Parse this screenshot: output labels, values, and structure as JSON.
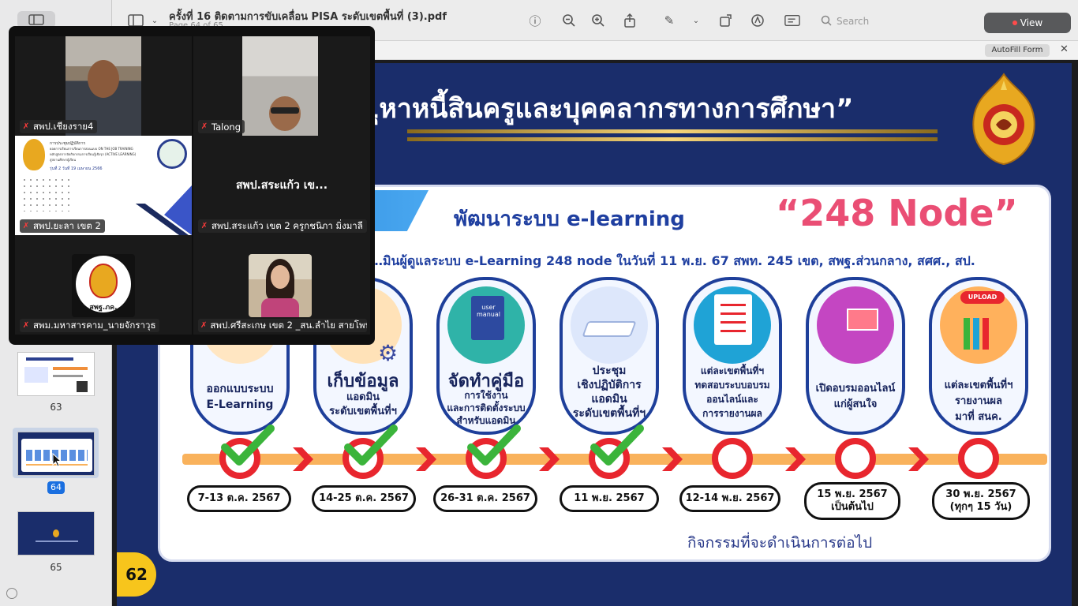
{
  "document": {
    "title": "ครั้งที่ 16 ติดตามการขับเคลื่อน PISA ระดับเขตพื้นที่ (3).pdf",
    "page_info": "Page 64 of 65"
  },
  "toolbar": {
    "search_placeholder": "Search",
    "view_label": "View",
    "autofill_label": "AutoFill Form",
    "close_label": "✕"
  },
  "sidebar": {
    "thumbnails": [
      {
        "label": "63",
        "selected": false
      },
      {
        "label": "64",
        "selected": true
      },
      {
        "label": "65",
        "selected": false
      }
    ]
  },
  "call": {
    "participants": [
      {
        "name": "สพป.เชียงราย4",
        "muted": true
      },
      {
        "name": "Talong",
        "muted": true
      },
      {
        "name": "สพป.ยะลา เขต 2",
        "muted": true
      },
      {
        "name": "สพป.สระแก้ว  เขต 2 ครูกชนิภา มิ่งมาลี",
        "muted": true,
        "display_name": "สพป.สระแก้ว  เข..."
      },
      {
        "name": "สพม.มหาสารคาม_นายจักราวุธ",
        "muted": true
      },
      {
        "name": "สพป.ศรีสะเกษ เขต 2 _สน.ลำไย สายโพน",
        "muted": true
      }
    ],
    "screen_share": {
      "line1": "การประชุมปฏิบัติการ",
      "line2": "ยอดการเรียนการเรียนการสอนแบบ ON THE JOB TRAINING",
      "line3": "หลักสูตรการจัดกิจกรรมการเรียนรู้เชิงรุก (ACTIVE LEARNING)",
      "line4": "สู่สถานศึกษาผู้เรียน",
      "date": "รุ่นที่ 2 วันที่ 19 เมษายน 2566"
    },
    "logo_caption": "สพฐ.ภค."
  },
  "slide": {
    "header": "…ุหาหนี้สินครูและบุคคลากรทางการศึกษา”",
    "panel_title": "พัฒนาระบบ e-learning",
    "panel_node": "“248 Node”",
    "panel_subtitle": "…มินผู้ดูแลระบบ e-Learning 248 node ในวันที่ 11 พ.ย. 67 สพท. 245 เขต, สพฐ.ส่วนกลาง, สศศ., สป.",
    "steps": [
      {
        "big": "",
        "text": "ออกแบบระบบ\nE-Learning",
        "status": "done",
        "date": "7-13 ต.ค. 2567"
      },
      {
        "big": "เก็บข้อมูล",
        "text": "แอดมิน\nระดับเขตพื้นที่ฯ",
        "status": "done",
        "date": "14-25 ต.ค. 2567"
      },
      {
        "big": "จัดทำคู่มือ",
        "text": "การใช้งาน\nและการติดตั้งระบบ\nสำหรับแอดมิน",
        "status": "done",
        "date": "26-31 ต.ค. 2567"
      },
      {
        "big": "",
        "text": "ประชุม\nเชิงปฏิบัติการ\nแอดมิน\nระดับเขตพื้นที่ฯ",
        "status": "done",
        "date": "11 พ.ย. 2567"
      },
      {
        "big": "",
        "text": "แต่ละเขตพื้นที่ฯ\nทดสอบระบบอบรม\nออนไลน์และ\nการรายงานผล",
        "status": "pending",
        "date": "12-14 พ.ย. 2567"
      },
      {
        "big": "",
        "text": "เปิดอบรมออนไลน์\nแก่ผู้สนใจ",
        "status": "pending",
        "date": "15 พ.ย. 2567\nเป็นต้นไป"
      },
      {
        "big": "",
        "text": "แต่ละเขตพื้นที่ฯ\nรายงานผล\nมาที่ สนค.",
        "status": "pending",
        "date": "30 พ.ย. 2567\n(ทุกๆ 15 วัน)"
      }
    ],
    "card_labels": {
      "manual": "user manual",
      "upload": "UPLOAD"
    },
    "footer": "กิจกรรมที่จะดำเนินการต่อไป",
    "page_number": "62"
  },
  "colors": {
    "slide_bg": "#1a2d6b",
    "accent_red": "#e8262e",
    "check_green": "#3bb43b",
    "title_blue": "#1f3fa0",
    "node_pink": "#ea4e74",
    "timeline_orange": "#f9b25c"
  },
  "icons": [
    "sidebar-toggle-icon",
    "info-icon",
    "zoom-out-icon",
    "zoom-in-icon",
    "share-icon",
    "highlight-icon",
    "chevron-down-icon",
    "rotate-icon",
    "markup-icon",
    "form-icon",
    "search-icon",
    "mic-muted-icon",
    "close-icon"
  ]
}
